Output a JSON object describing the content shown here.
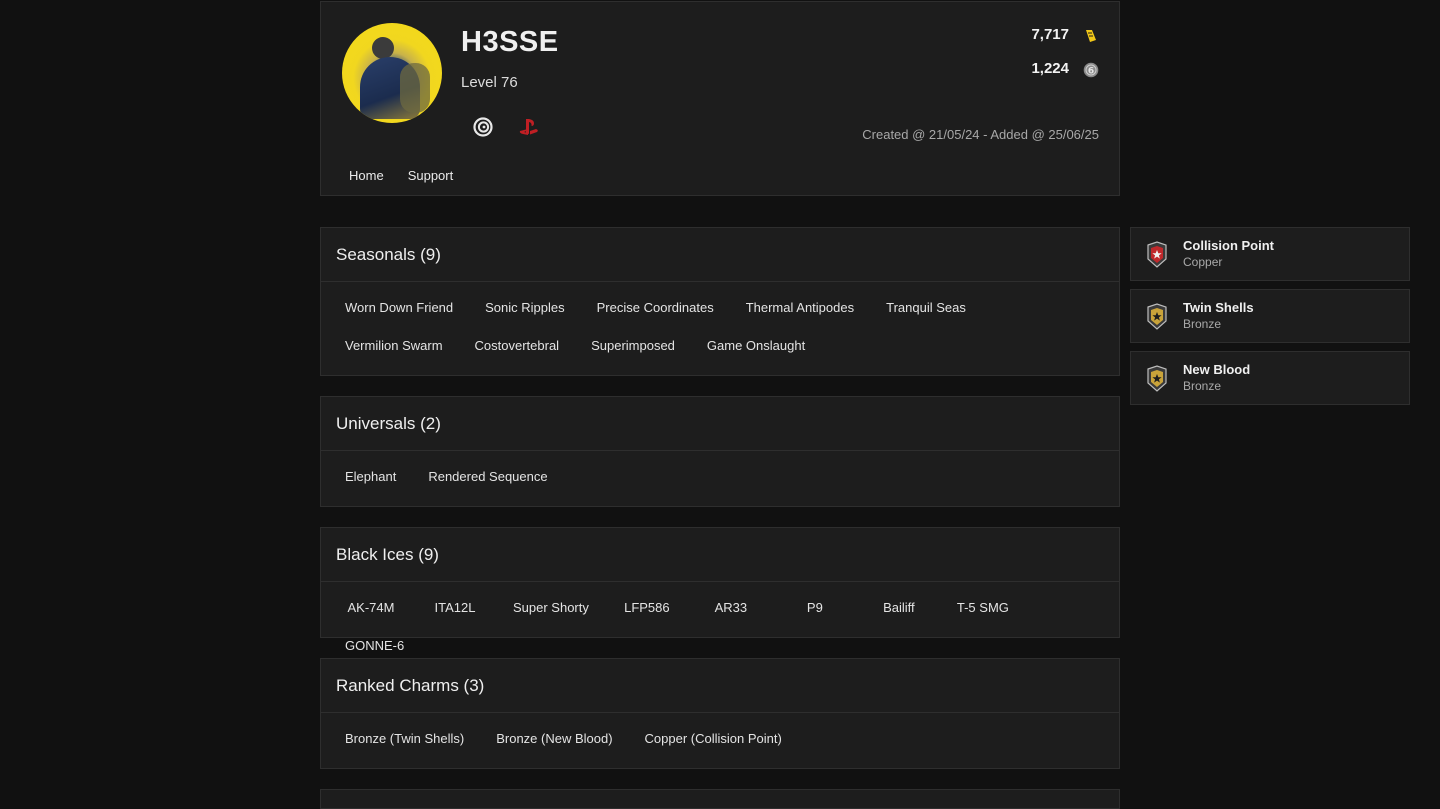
{
  "profile": {
    "username": "H3SSE",
    "level": "Level 76",
    "renown": "7,717",
    "credits": "1,224",
    "created": "Created @ 21/05/24 - Added @ 25/06/25",
    "platforms": [
      "ubisoft-icon",
      "playstation-icon"
    ]
  },
  "nav": {
    "home": "Home",
    "support": "Support"
  },
  "sections": [
    {
      "title": "Seasonals (9)",
      "items": [
        "Worn Down Friend",
        "Sonic Ripples",
        "Precise Coordinates",
        "Thermal Antipodes",
        "Tranquil Seas",
        "Vermilion Swarm",
        "Costovertebral",
        "Superimposed",
        "Game Onslaught"
      ]
    },
    {
      "title": "Universals (2)",
      "items": [
        "Elephant",
        "Rendered Sequence"
      ]
    },
    {
      "title": "Black Ices (9)",
      "items": [
        "AK-74M",
        "ITA12L",
        "Super Shorty",
        "LFP586",
        "AR33",
        "P9",
        "Bailiff",
        "T-5 SMG",
        "GONNE-6"
      ]
    },
    {
      "title": "Ranked Charms (3)",
      "items": [
        "Bronze (Twin Shells)",
        "Bronze (New Blood)",
        "Copper (Collision Point)"
      ]
    }
  ],
  "ranks": [
    {
      "name": "Collision Point",
      "tier": "Copper",
      "color": "#c0282b"
    },
    {
      "name": "Twin Shells",
      "tier": "Bronze",
      "color": "#c9a33a"
    },
    {
      "name": "New Blood",
      "tier": "Bronze",
      "color": "#c9a33a"
    }
  ],
  "colors": {
    "background": "#111111",
    "panel": "#1d1d1d",
    "renown": "#f2c818",
    "psn": "#c01f24"
  }
}
